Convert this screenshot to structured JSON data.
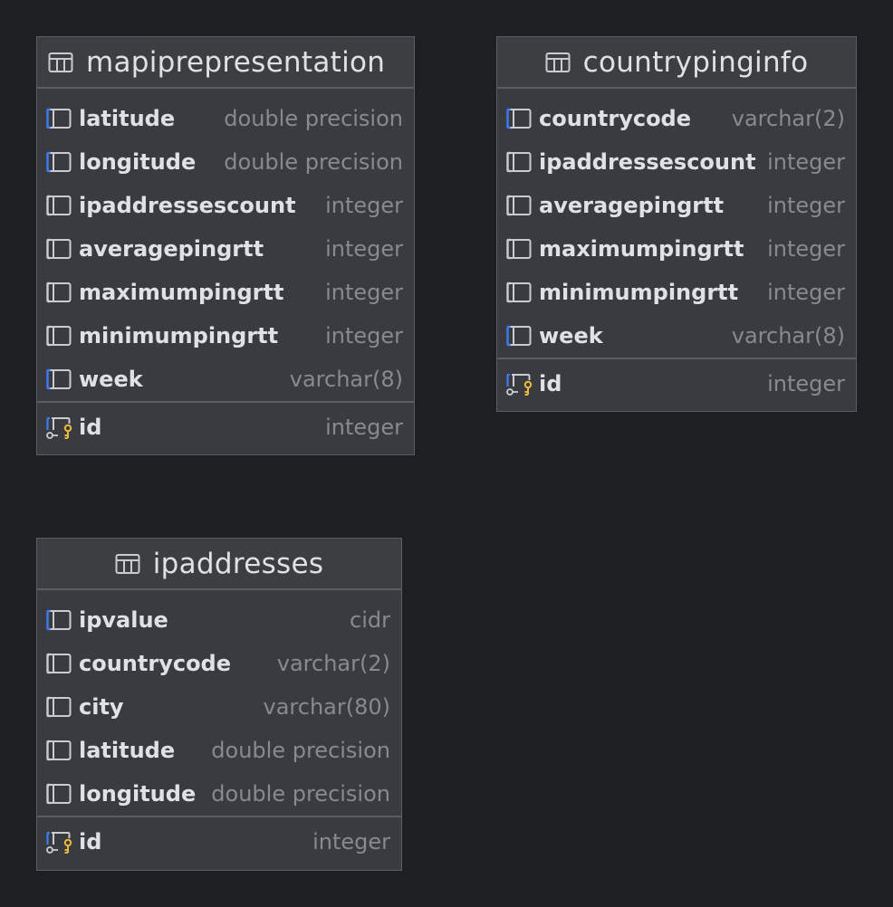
{
  "tables": {
    "mapiprepresentation": {
      "title": "mapiprepresentation",
      "columns": [
        {
          "name": "latitude",
          "type": "double precision",
          "highlight": true
        },
        {
          "name": "longitude",
          "type": "double precision",
          "highlight": true
        },
        {
          "name": "ipaddressescount",
          "type": "integer",
          "highlight": false
        },
        {
          "name": "averagepingrtt",
          "type": "integer",
          "highlight": false
        },
        {
          "name": "maximumpingrtt",
          "type": "integer",
          "highlight": false
        },
        {
          "name": "minimumpingrtt",
          "type": "integer",
          "highlight": false
        },
        {
          "name": "week",
          "type": "varchar(8)",
          "highlight": true
        }
      ],
      "pk": {
        "name": "id",
        "type": "integer"
      }
    },
    "countrypinginfo": {
      "title": "countrypinginfo",
      "columns": [
        {
          "name": "countrycode",
          "type": "varchar(2)",
          "highlight": true
        },
        {
          "name": "ipaddressescount",
          "type": "integer",
          "highlight": false
        },
        {
          "name": "averagepingrtt",
          "type": "integer",
          "highlight": false
        },
        {
          "name": "maximumpingrtt",
          "type": "integer",
          "highlight": false
        },
        {
          "name": "minimumpingrtt",
          "type": "integer",
          "highlight": false
        },
        {
          "name": "week",
          "type": "varchar(8)",
          "highlight": true
        }
      ],
      "pk": {
        "name": "id",
        "type": "integer"
      }
    },
    "ipaddresses": {
      "title": "ipaddresses",
      "columns": [
        {
          "name": "ipvalue",
          "type": "cidr",
          "highlight": true
        },
        {
          "name": "countrycode",
          "type": "varchar(2)",
          "highlight": false
        },
        {
          "name": "city",
          "type": "varchar(80)",
          "highlight": false
        },
        {
          "name": "latitude",
          "type": "double precision",
          "highlight": false
        },
        {
          "name": "longitude",
          "type": "double precision",
          "highlight": false
        }
      ],
      "pk": {
        "name": "id",
        "type": "integer"
      }
    }
  },
  "icons": {
    "table": "table-icon",
    "column": "column-icon",
    "indexed_column": "indexed-column-icon",
    "primary_key": "primary-key-icon"
  },
  "colors": {
    "background": "#1e1f22",
    "table_body": "#393b40",
    "header": "#3c3f41",
    "border": "#5a5d63",
    "text": "#dfe1e5",
    "type_text": "#868a91",
    "index_accent": "#3d7bf2",
    "key_accent": "#e8b93c"
  }
}
